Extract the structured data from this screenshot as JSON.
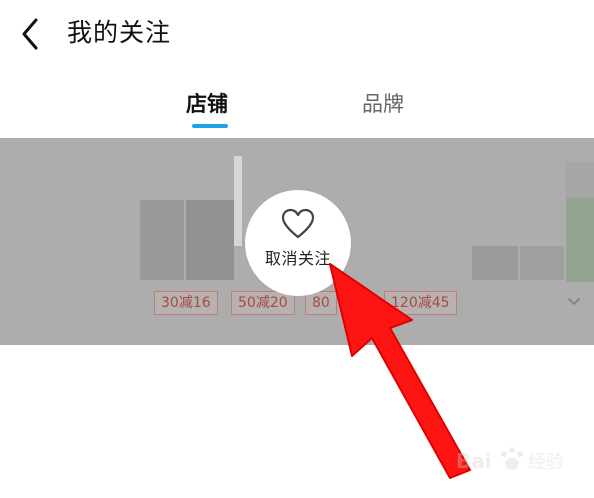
{
  "header": {
    "title": "我的关注",
    "back_icon": "chevron-left-icon"
  },
  "tabs": [
    {
      "label": "店铺",
      "active": true
    },
    {
      "label": "品牌",
      "active": false
    }
  ],
  "accent_color": "#1aa4e6",
  "shop_card": {
    "coupons": [
      "30减16",
      "50减20",
      "80",
      "120减45"
    ],
    "expand_icon": "chevron-down-icon"
  },
  "unfollow": {
    "label": "取消关注",
    "icon": "heart-outline-icon"
  },
  "annotation": {
    "arrow_color": "#ff0000"
  },
  "watermark": {
    "text": "Bai 经验"
  }
}
